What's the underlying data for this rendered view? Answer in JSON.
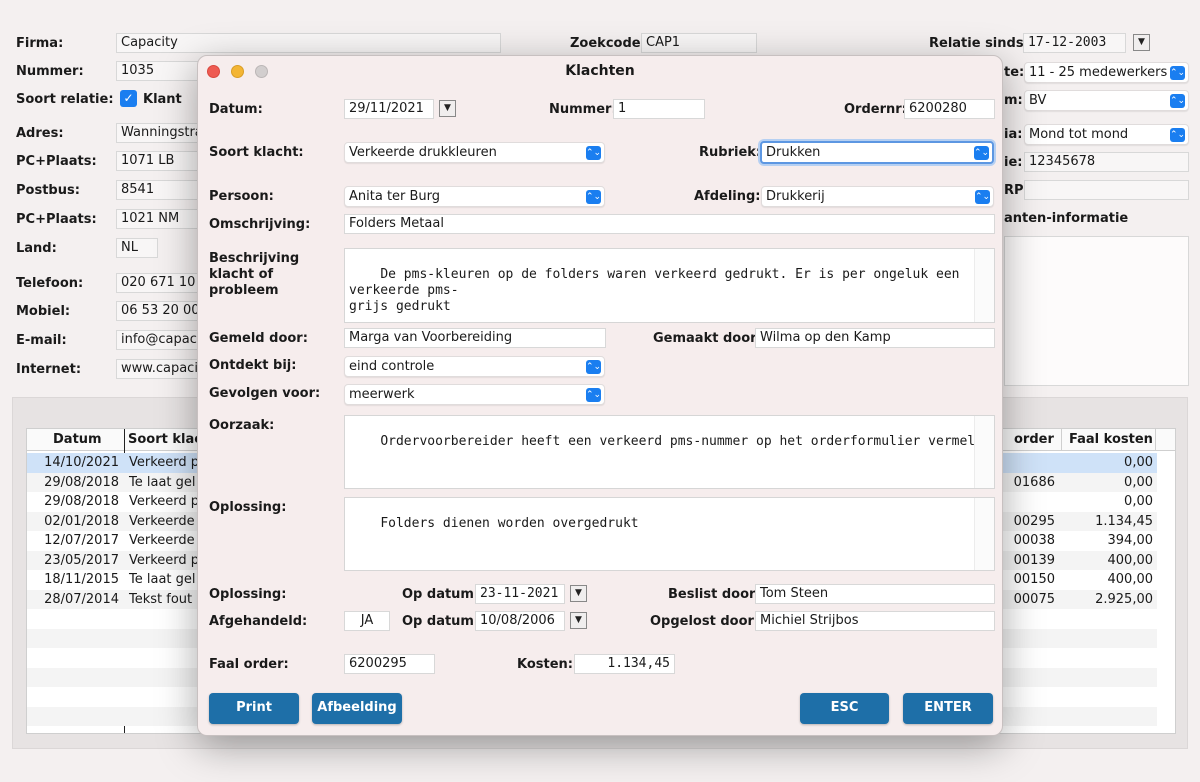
{
  "background": {
    "firma_label": "Firma:",
    "firma_value": "Capacity",
    "zoekcode_label": "Zoekcode:",
    "zoekcode_value": "CAP1",
    "relatie_sinds_label": "Relatie sinds:",
    "relatie_sinds_value": "17-12-2003",
    "nummer_label": "Nummer:",
    "nummer_value": "1035",
    "soort_relatie_label": "Soort relatie:",
    "klant_label": "Klant",
    "adres_label": "Adres:",
    "adres_value": "Wanningstra",
    "pcplaats_label": "PC+Plaats:",
    "pcplaats_value": "1071 LB",
    "postbus_label": "Postbus:",
    "postbus_value": "8541",
    "pcplaats2_label": "PC+Plaats:",
    "pcplaats2_value": "1021 NM",
    "land_label": "Land:",
    "land_value": "NL",
    "telefoon_label": "Telefoon:",
    "telefoon_value": "020 671 10",
    "mobiel_label": "Mobiel:",
    "mobiel_value": "06 53 20 00",
    "email_label": "E-mail:",
    "email_value": "info@capaci",
    "internet_label": "Internet:",
    "internet_value": "www.capaci",
    "right_label_1": "te:",
    "right_value_1": "11 - 25 medewerkers",
    "right_label_2": "m:",
    "right_value_2": "BV",
    "right_label_3": "ia:",
    "right_value_3": "Mond tot mond",
    "right_label_4": "ie:",
    "right_value_4": "12345678",
    "right_label_5": "RP:",
    "right_label_6": "anten-informatie",
    "table": {
      "headers": {
        "datum": "Datum",
        "soort": "Soort klac",
        "order": "order",
        "faal": "Faal kosten"
      },
      "rows": [
        {
          "datum": "14/10/2021",
          "soort": "Verkeerd p",
          "order": "",
          "faal": "0,00"
        },
        {
          "datum": "29/08/2018",
          "soort": "Te laat gel",
          "order": "01686",
          "faal": "0,00"
        },
        {
          "datum": "29/08/2018",
          "soort": "Verkeerd p",
          "order": "",
          "faal": "0,00"
        },
        {
          "datum": "02/01/2018",
          "soort": "Verkeerde",
          "order": "00295",
          "faal": "1.134,45"
        },
        {
          "datum": "12/07/2017",
          "soort": "Verkeerde",
          "order": "00038",
          "faal": "394,00"
        },
        {
          "datum": "23/05/2017",
          "soort": "Verkeerd p",
          "order": "00139",
          "faal": "400,00"
        },
        {
          "datum": "18/11/2015",
          "soort": "Te laat gel",
          "order": "00150",
          "faal": "400,00"
        },
        {
          "datum": "28/07/2014",
          "soort": "Tekst fout",
          "order": "00075",
          "faal": "2.925,00"
        }
      ]
    }
  },
  "dialog": {
    "title": "Klachten",
    "datum_label": "Datum:",
    "datum_value": "29/11/2021",
    "nummer_label": "Nummer:",
    "nummer_value": "1",
    "ordernr_label": "Ordernr:",
    "ordernr_value": "6200280",
    "soort_klacht_label": "Soort klacht:",
    "soort_klacht_value": "Verkeerde drukkleuren",
    "rubriek_label": "Rubriek:",
    "rubriek_value": "Drukken",
    "persoon_label": "Persoon:",
    "persoon_value": "Anita ter Burg",
    "afdeling_label": "Afdeling:",
    "afdeling_value": "Drukkerij",
    "omschrijving_label": "Omschrijving:",
    "omschrijving_value": "Folders Metaal",
    "beschrijving_label_1": "Beschrijving",
    "beschrijving_label_2": "klacht of",
    "beschrijving_label_3": "probleem",
    "beschrijving_value": "De pms-kleuren op de folders waren verkeerd gedrukt. Er is per ongeluk een verkeerde pms-\ngrijs gedrukt",
    "gemeld_door_label": "Gemeld door:",
    "gemeld_door_value": "Marga van Voorbereiding",
    "gemaakt_door_label": "Gemaakt door:",
    "gemaakt_door_value": "Wilma op den Kamp",
    "ontdekt_bij_label": "Ontdekt bij:",
    "ontdekt_bij_value": "eind controle",
    "gevolgen_voor_label": "Gevolgen voor:",
    "gevolgen_voor_value": "meerwerk",
    "oorzaak_label": "Oorzaak:",
    "oorzaak_value": "Ordervoorbereider heeft een verkeerd pms-nummer op het orderformulier vermeld",
    "oplossing_label": "Oplossing:",
    "oplossing_value": "Folders dienen worden overgedrukt",
    "oplossing2_label": "Oplossing:",
    "op_datum_label_1": "Op datum:",
    "op_datum_value_1": "23-11-2021",
    "beslist_door_label": "Beslist door:",
    "beslist_door_value": "Tom Steen",
    "afgehandeld_label": "Afgehandeld:",
    "afgehandeld_value": "JA",
    "op_datum_label_2": "Op datum:",
    "op_datum_value_2": "10/08/2006",
    "opgelost_door_label": "Opgelost door:",
    "opgelost_door_value": "Michiel Strijbos",
    "faal_order_label": "Faal order:",
    "faal_order_value": "6200295",
    "kosten_label": "Kosten:",
    "kosten_value": "1.134,45",
    "print_label": "Print",
    "afbeelding_label": "Afbeelding",
    "esc_label": "ESC",
    "enter_label": "ENTER"
  },
  "colors": {
    "button": "#1e6fa8",
    "combo_arrow": "#1a7ef0",
    "selected_row": "#cfe2f8"
  },
  "icons": {
    "dropdown": "chevron-updown-icon",
    "date_picker": "calendar-dropdown-icon",
    "checkbox": "checkmark-icon"
  }
}
